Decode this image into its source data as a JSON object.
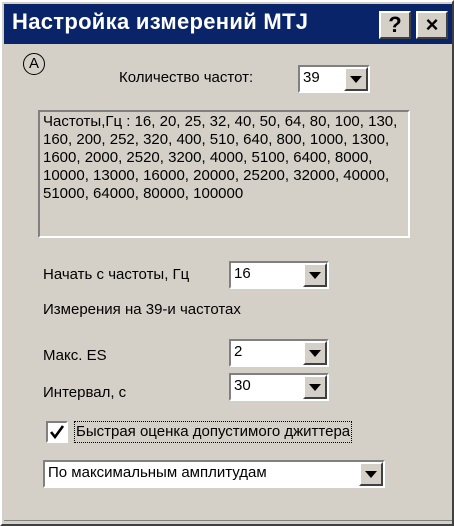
{
  "window": {
    "title": "Настройка измерений MTJ",
    "help_label": "?",
    "close_label": "×"
  },
  "marker": "A",
  "freq_count": {
    "label": "Количество частот:",
    "value": "39"
  },
  "freq_list": {
    "text": "Частоты,Гц : 16, 20, 25, 32, 40, 50, 64, 80, 100, 130, 160, 200, 252, 320, 400, 510, 640, 800, 1000, 1300, 1600, 2000, 2520, 3200, 4000, 5100, 6400, 8000, 10000, 13000, 16000, 20000, 25200, 32000, 40000, 51000, 64000, 80000, 100000"
  },
  "start_freq": {
    "label": "Начать с частоты, Гц",
    "value": "16"
  },
  "measure_info": "Измерения на 39-и частотах",
  "max_es": {
    "label": "Макс. ES",
    "value": "2"
  },
  "interval": {
    "label": "Интервал, с",
    "value": "30"
  },
  "jitter_check": {
    "label": "Быстрая оценка допустимого джиттера",
    "checked": true
  },
  "mode_select": {
    "value": "По максимальным амплитудам"
  },
  "colors": {
    "titlebar": "#0a246a",
    "face": "#d4d0c8"
  }
}
